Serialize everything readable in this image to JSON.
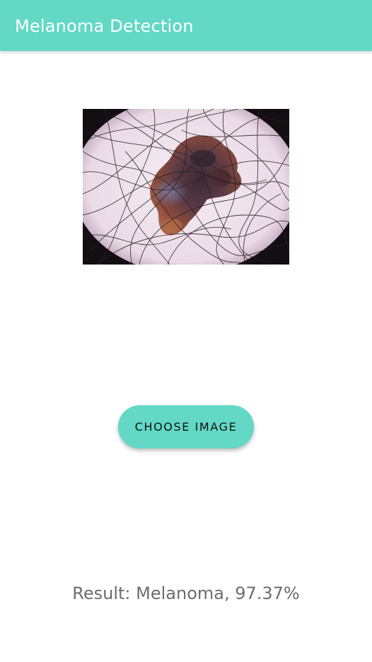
{
  "app_bar": {
    "title": "Melanoma Detection",
    "color": "#62d8c5"
  },
  "preview": {
    "icon": "skin-lesion-image",
    "description": "dermoscopic skin lesion photo"
  },
  "actions": {
    "choose_image_label": "CHOOSE IMAGE",
    "button_color": "#62d8c5"
  },
  "result": {
    "text": "Result: Melanoma, 97.37%"
  }
}
